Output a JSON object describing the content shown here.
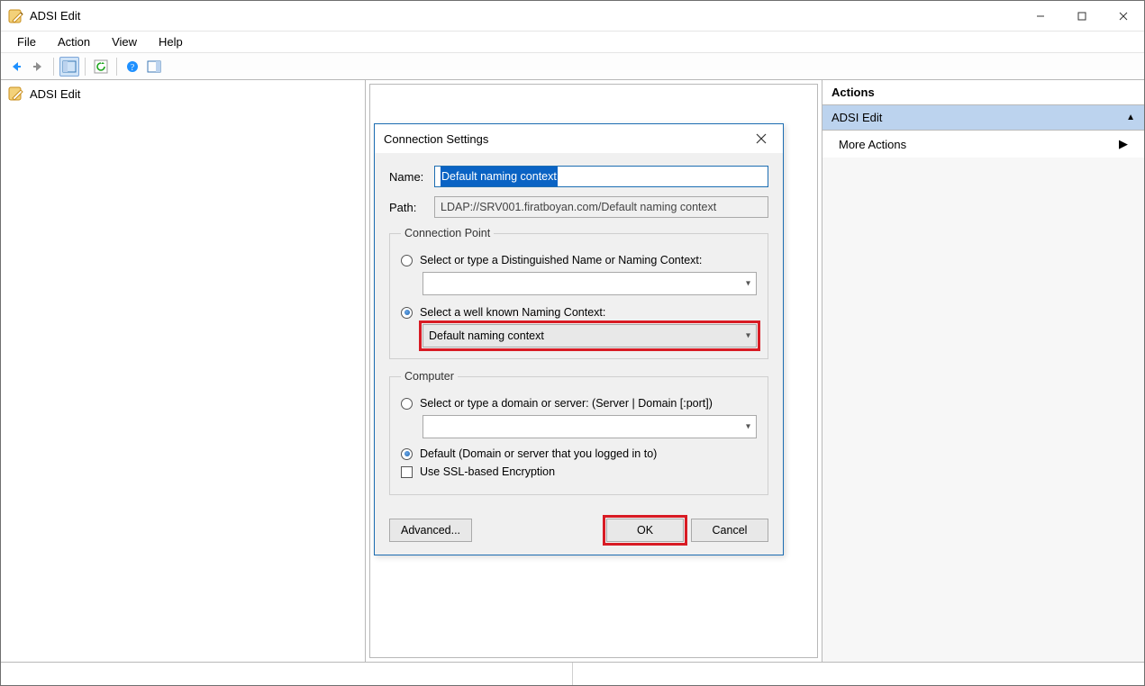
{
  "window": {
    "title": "ADSI Edit"
  },
  "menubar": {
    "file": "File",
    "action": "Action",
    "view": "View",
    "help": "Help"
  },
  "tree": {
    "root_label": "ADSI Edit"
  },
  "actions_panel": {
    "header": "Actions",
    "section": "ADSI Edit",
    "more_actions": "More Actions"
  },
  "dialog": {
    "title": "Connection Settings",
    "name_label": "Name:",
    "name_value": "Default naming context",
    "path_label": "Path:",
    "path_value": "LDAP://SRV001.firatboyan.com/Default naming context",
    "connection_point": {
      "legend": "Connection Point",
      "radio_dn": "Select or type a Distinguished Name or Naming Context:",
      "radio_wellknown": "Select a well known Naming Context:",
      "combo_dn_value": "",
      "combo_wellknown_value": "Default naming context"
    },
    "computer": {
      "legend": "Computer",
      "radio_domain": "Select or type a domain or server: (Server | Domain [:port])",
      "radio_default": "Default (Domain or server that you logged in to)",
      "combo_domain_value": "",
      "ssl_label": "Use SSL-based Encryption"
    },
    "buttons": {
      "advanced": "Advanced...",
      "ok": "OK",
      "cancel": "Cancel"
    }
  }
}
